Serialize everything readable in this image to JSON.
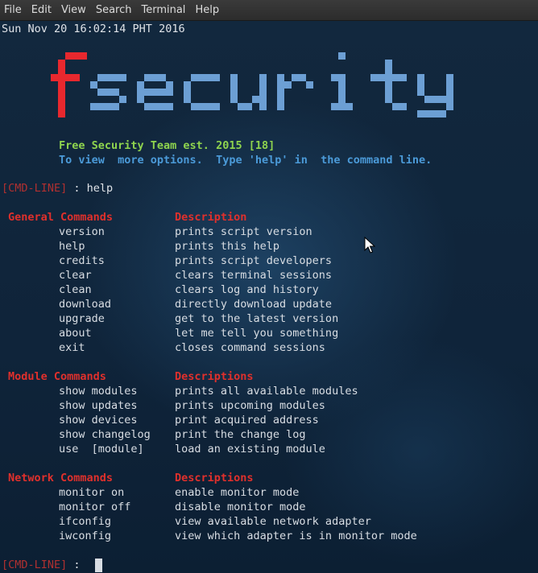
{
  "menubar": {
    "items": [
      "File",
      "Edit",
      "View",
      "Search",
      "Terminal",
      "Help"
    ]
  },
  "terminal": {
    "timestamp": "Sun Nov 20 16:02:14 PHT 2016",
    "banner": {
      "logo_red_letter": "f",
      "logo_blue_text": "security",
      "colors": {
        "red": "#e8282e",
        "blue": "#6c9fd4"
      }
    },
    "team_line": "Free Security Team est. 2015 [18]",
    "hint_line": "To view  more options.  Type 'help' in  the command line.",
    "prompt_label": "[CMD-LINE]",
    "prompt_sep": " : ",
    "entered_command": "help",
    "sections": [
      {
        "heading": "General Commands",
        "desc_heading": "Description",
        "rows": [
          {
            "cmd": "version",
            "desc": "prints script version"
          },
          {
            "cmd": "help",
            "desc": "prints this help"
          },
          {
            "cmd": "credits",
            "desc": "prints script developers"
          },
          {
            "cmd": "clear",
            "desc": "clears terminal sessions"
          },
          {
            "cmd": "clean",
            "desc": "clears log and history"
          },
          {
            "cmd": "download",
            "desc": "directly download update"
          },
          {
            "cmd": "upgrade",
            "desc": "get to the latest version"
          },
          {
            "cmd": "about",
            "desc": "let me tell you something"
          },
          {
            "cmd": "exit",
            "desc": "closes command sessions"
          }
        ]
      },
      {
        "heading": "Module Commands",
        "desc_heading": "Descriptions",
        "rows": [
          {
            "cmd": "show modules",
            "desc": "prints all available modules"
          },
          {
            "cmd": "show updates",
            "desc": "prints upcoming modules"
          },
          {
            "cmd": "show devices",
            "desc": "print acquired address"
          },
          {
            "cmd": "show changelog",
            "desc": "print the change log"
          },
          {
            "cmd": "use  [module]",
            "desc": "load an existing module"
          }
        ]
      },
      {
        "heading": "Network Commands",
        "desc_heading": "Descriptions",
        "rows": [
          {
            "cmd": "monitor on",
            "desc": "enable monitor mode"
          },
          {
            "cmd": "monitor off",
            "desc": "disable monitor mode"
          },
          {
            "cmd": "ifconfig",
            "desc": "view available network adapter"
          },
          {
            "cmd": "iwconfig",
            "desc": "view which adapter is in monitor mode"
          }
        ]
      }
    ],
    "final_prompt_label": "[CMD-LINE]",
    "final_prompt_sep": " : "
  }
}
